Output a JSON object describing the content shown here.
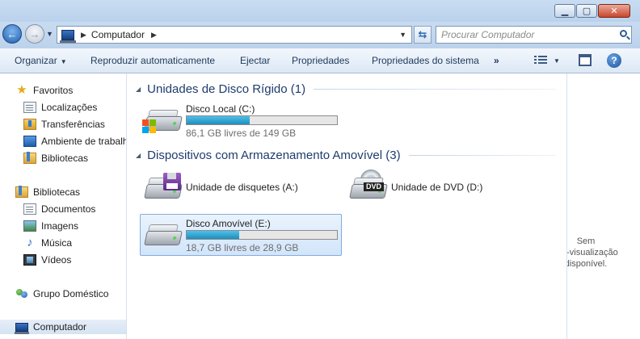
{
  "window": {
    "minimize_label": "▁",
    "maximize_label": "▢",
    "close_label": "✕"
  },
  "address": {
    "path": "Computador",
    "search_placeholder": "Procurar Computador"
  },
  "toolbar": {
    "organize": "Organizar",
    "autoplay": "Reproduzir automaticamente",
    "eject": "Ejectar",
    "properties": "Propriedades",
    "system_properties": "Propriedades do sistema",
    "more": "»"
  },
  "nav": {
    "favorites": "Favoritos",
    "locations": "Localizações",
    "downloads": "Transferências",
    "desktop": "Ambiente de trabalho",
    "favorites_libraries": "Bibliotecas",
    "libraries": "Bibliotecas",
    "documents": "Documentos",
    "images": "Imagens",
    "music": "Música",
    "videos": "Vídeos",
    "homegroup": "Grupo Doméstico",
    "computer": "Computador"
  },
  "groups": {
    "hdd_header": "Unidades de Disco Rígido (1)",
    "removable_header": "Dispositivos com Armazenamento Amovível (3)"
  },
  "drives": {
    "local_c": {
      "name": "Disco Local (C:)",
      "free": "86,1 GB livres de 149 GB",
      "used_fraction": 0.42
    },
    "floppy_a": {
      "name": "Unidade de disquetes (A:)"
    },
    "dvd_d": {
      "name": "Unidade de DVD (D:)",
      "badge": "DVD"
    },
    "removable_e": {
      "name": "Disco Amovível (E:)",
      "free": "18,7 GB livres de 28,9 GB",
      "used_fraction": 0.35
    }
  },
  "preview": {
    "line1": "Sem",
    "line2": "pré-visualização",
    "line3": "disponível."
  }
}
